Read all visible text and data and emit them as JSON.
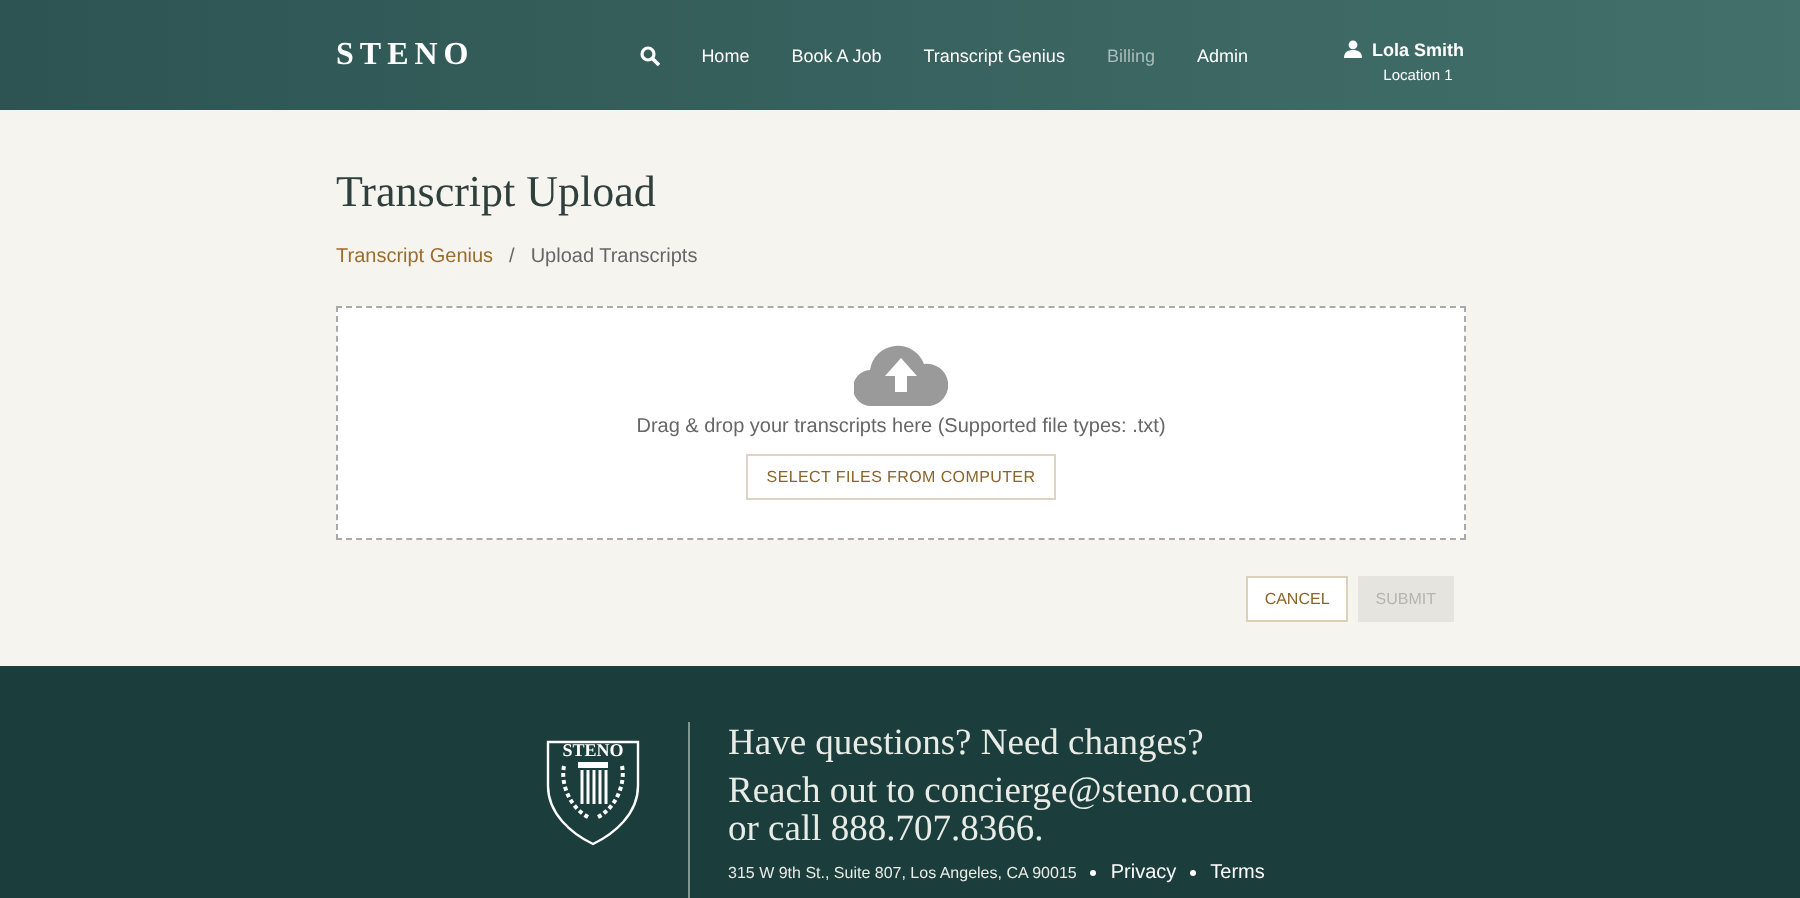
{
  "header": {
    "logo": "STENO",
    "nav": [
      {
        "label": "Home",
        "disabled": false
      },
      {
        "label": "Book A Job",
        "disabled": false
      },
      {
        "label": "Transcript Genius",
        "disabled": false
      },
      {
        "label": "Billing",
        "disabled": true
      },
      {
        "label": "Admin",
        "disabled": false
      }
    ],
    "user": {
      "name": "Lola Smith",
      "location": "Location 1"
    }
  },
  "page": {
    "title": "Transcript Upload",
    "breadcrumb": [
      {
        "label": "Transcript Genius",
        "kind": "link"
      },
      {
        "label": "/",
        "kind": "separator"
      },
      {
        "label": "Upload Transcripts",
        "kind": "current"
      }
    ],
    "dropzone": {
      "hint": "Drag & drop your transcripts here (Supported file types: .txt)",
      "button": "SELECT FILES FROM COMPUTER"
    },
    "actions": [
      {
        "label": "CANCEL",
        "disabled": false
      },
      {
        "label": "SUBMIT",
        "disabled": true
      }
    ]
  },
  "footer": {
    "logo_text": "STENO",
    "heading": "Have questions? Need changes?",
    "contact_line_1": "Reach out to concierge@steno.com",
    "contact_line_2": "or call 888.707.8366.",
    "address": "315 W 9th St., Suite 807, Los Angeles, CA 90015",
    "links": [
      "Privacy",
      "Terms"
    ]
  }
}
